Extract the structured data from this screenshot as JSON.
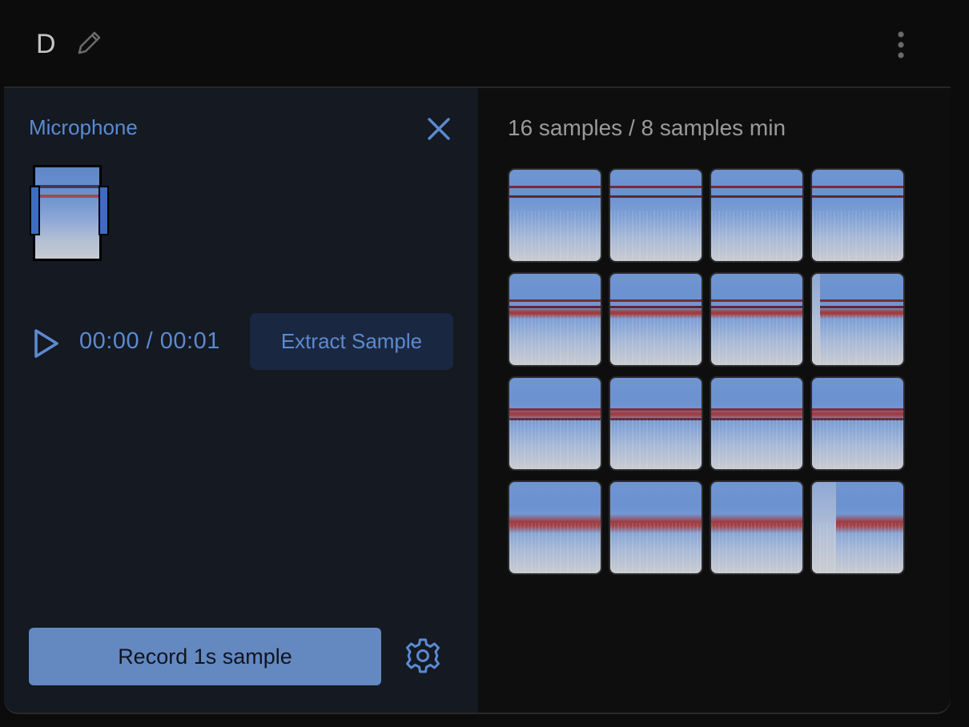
{
  "header": {
    "class_name": "D",
    "edit_icon": "pencil-icon",
    "more_icon": "more-vert-icon"
  },
  "recorder": {
    "title": "Microphone",
    "close_icon": "close-icon",
    "time_current": "00:00",
    "time_separator": " / ",
    "time_total": "00:01",
    "extract_label": "Extract Sample",
    "record_label": "Record 1s sample",
    "settings_icon": "gear-icon",
    "play_icon": "play-icon"
  },
  "samples": {
    "count_label": "16 samples / 8 samples min",
    "count": 16,
    "minimum": 8
  },
  "colors": {
    "accent": "#5b8ad0",
    "record_button": "#6489c0",
    "extract_button_bg": "#1a2740",
    "left_panel_bg": "#141922"
  }
}
